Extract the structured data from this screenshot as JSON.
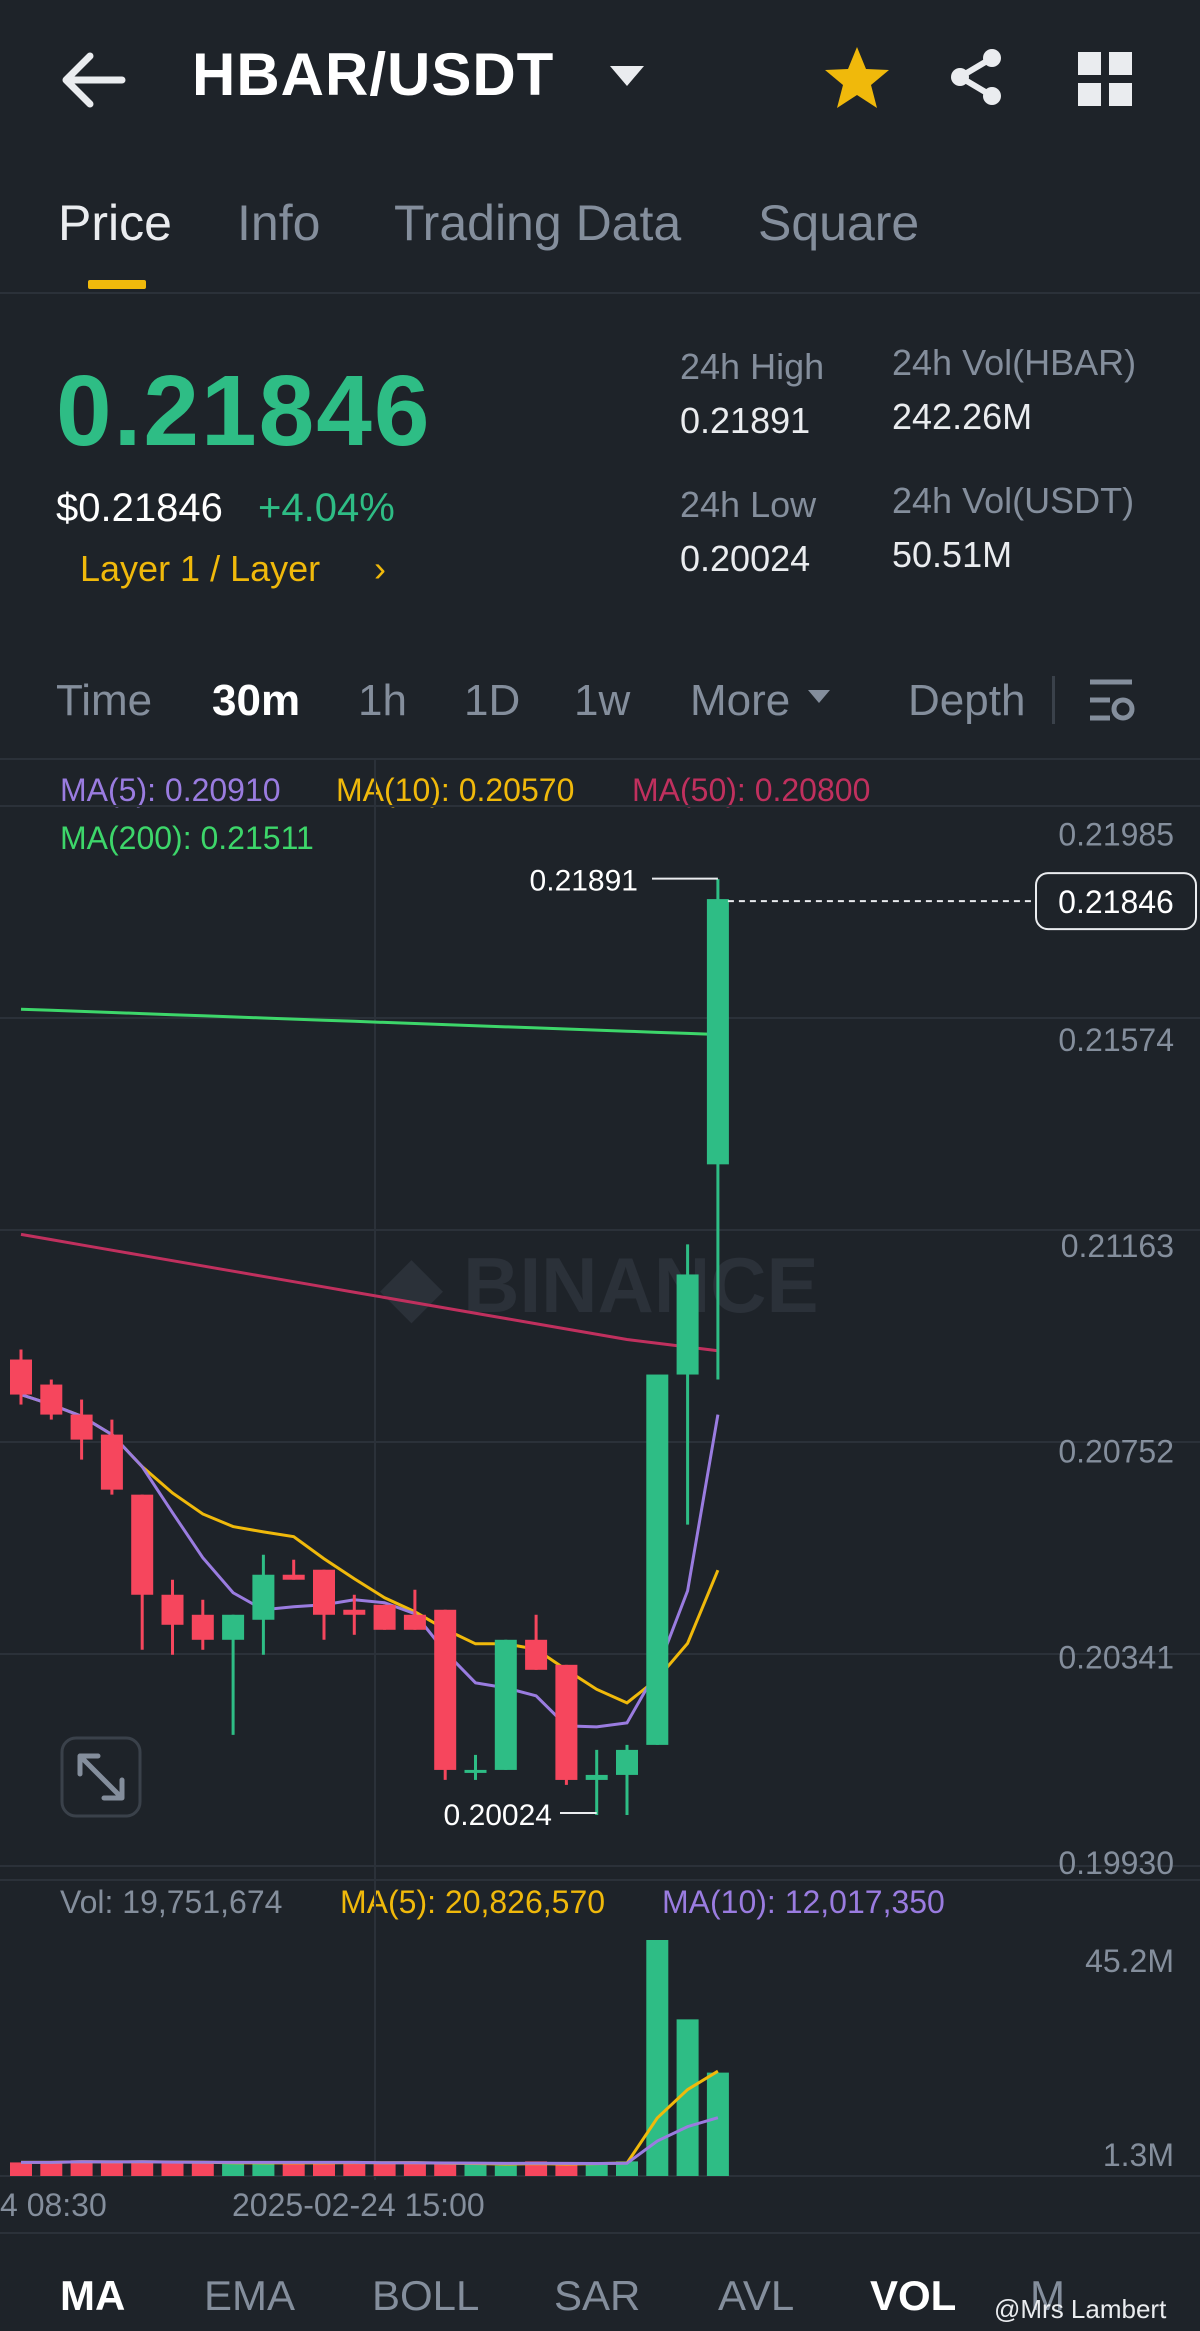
{
  "header": {
    "title": "HBAR/USDT",
    "colors": {
      "accent": "#f0b90b",
      "up": "#2ebd85",
      "down": "#f6465d",
      "background": "#1e2329"
    }
  },
  "tabs": [
    {
      "label": "Price",
      "active": true
    },
    {
      "label": "Info"
    },
    {
      "label": "Trading Data"
    },
    {
      "label": "Square"
    }
  ],
  "price": {
    "last": "0.21846",
    "usd": "$0.21846",
    "change": "+4.04%",
    "tag": "Layer 1 / Layer",
    "tag_chevron": "›"
  },
  "stats": {
    "high_label": "24h High",
    "high_value": "0.21891",
    "low_label": "24h Low",
    "low_value": "0.20024",
    "vol_base_label": "24h Vol(HBAR)",
    "vol_base_value": "242.26M",
    "vol_quote_label": "24h Vol(USDT)",
    "vol_quote_value": "50.51M"
  },
  "timeframes": [
    {
      "label": "Time"
    },
    {
      "label": "30m",
      "active": true
    },
    {
      "label": "1h"
    },
    {
      "label": "1D"
    },
    {
      "label": "1w"
    },
    {
      "label": "More"
    },
    {
      "label": "Depth"
    }
  ],
  "legend": {
    "ma5": "MA(5): 0.20910",
    "ma10": "MA(10): 0.20570",
    "ma50": "MA(50): 0.20800",
    "ma200": "MA(200): 0.21511",
    "vol": "Vol: 19,751,674",
    "vol_ma5": "MA(5): 20,826,570",
    "vol_ma10": "MA(10): 12,017,350"
  },
  "chart_data": {
    "type": "candlestick",
    "ylim": [
      0.1993,
      0.22048
    ],
    "yticks": [
      "0.21985",
      "0.21574",
      "0.21163",
      "0.20752",
      "0.20341",
      "0.19930"
    ],
    "last_price_label": "0.21846",
    "high_marker": "0.21891",
    "low_marker": "0.20024",
    "watermark": "BINANCE",
    "xticks": [
      "4 08:30",
      "2025-02-24 15:00"
    ],
    "candles": [
      {
        "o": 0.2093,
        "h": 0.2095,
        "c": 0.2086,
        "l": 0.2084
      },
      {
        "o": 0.2088,
        "h": 0.2089,
        "c": 0.2082,
        "l": 0.2081
      },
      {
        "o": 0.2082,
        "h": 0.2085,
        "c": 0.2077,
        "l": 0.2073
      },
      {
        "o": 0.2078,
        "h": 0.2081,
        "c": 0.2067,
        "l": 0.2066
      },
      {
        "o": 0.2066,
        "h": 0.2066,
        "c": 0.2046,
        "l": 0.2035
      },
      {
        "o": 0.2046,
        "h": 0.2049,
        "c": 0.204,
        "l": 0.2034
      },
      {
        "o": 0.2042,
        "h": 0.2045,
        "c": 0.2037,
        "l": 0.2035
      },
      {
        "o": 0.2037,
        "h": 0.2042,
        "c": 0.2042,
        "l": 0.2018
      },
      {
        "o": 0.2041,
        "h": 0.2054,
        "c": 0.205,
        "l": 0.2034
      },
      {
        "o": 0.205,
        "h": 0.2053,
        "c": 0.2049,
        "l": 0.2049
      },
      {
        "o": 0.2051,
        "h": 0.2051,
        "c": 0.2042,
        "l": 0.2037
      },
      {
        "o": 0.2043,
        "h": 0.2046,
        "c": 0.2042,
        "l": 0.2038
      },
      {
        "o": 0.2044,
        "h": 0.2044,
        "c": 0.2039,
        "l": 0.2039
      },
      {
        "o": 0.2042,
        "h": 0.2047,
        "c": 0.2039,
        "l": 0.2039
      },
      {
        "o": 0.2043,
        "h": 0.2043,
        "c": 0.2011,
        "l": 0.2009
      },
      {
        "o": 0.2011,
        "h": 0.2014,
        "c": 0.2011,
        "l": 0.2009
      },
      {
        "o": 0.2011,
        "h": 0.2037,
        "c": 0.2037,
        "l": 0.2011
      },
      {
        "o": 0.2037,
        "h": 0.2042,
        "c": 0.2031,
        "l": 0.2031
      },
      {
        "o": 0.2032,
        "h": 0.2032,
        "c": 0.2009,
        "l": 0.2008
      },
      {
        "o": 0.2009,
        "h": 0.2015,
        "c": 0.201,
        "l": 0.2002
      },
      {
        "o": 0.201,
        "h": 0.2016,
        "c": 0.2015,
        "l": 0.2002
      },
      {
        "o": 0.2016,
        "h": 0.2079,
        "c": 0.209,
        "l": 0.2016
      },
      {
        "o": 0.209,
        "h": 0.2116,
        "c": 0.211,
        "l": 0.206
      },
      {
        "o": 0.2132,
        "h": 0.2189,
        "c": 0.2185,
        "l": 0.2089
      }
    ],
    "volume": [
      2.6,
      2.6,
      3.0,
      2.6,
      2.8,
      2.4,
      2.4,
      2.5,
      2.5,
      2.8,
      2.4,
      2.6,
      2.4,
      2.6,
      2.2,
      2.2,
      2.0,
      2.8,
      2.2,
      2.6,
      2.8,
      45.2,
      30.0,
      19.8
    ],
    "volume_labels": [
      "45.2M",
      "1.3M"
    ],
    "volume_ylim": [
      0,
      45.2
    ]
  },
  "bottom_indicators": [
    {
      "label": "MA",
      "active": true
    },
    {
      "label": "EMA"
    },
    {
      "label": "BOLL"
    },
    {
      "label": "SAR"
    },
    {
      "label": "AVL"
    },
    {
      "label": "VOL",
      "active": true
    },
    {
      "label": "M"
    }
  ],
  "watermark_credit": "@Mrs Lambert"
}
